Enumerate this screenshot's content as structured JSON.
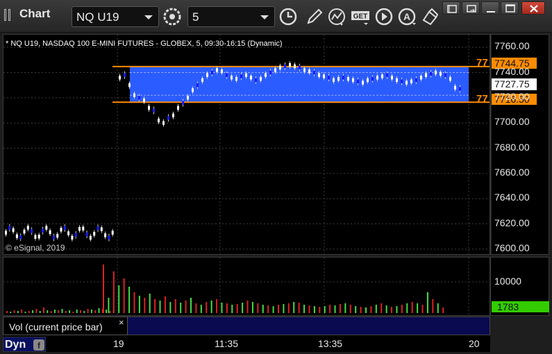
{
  "toolbar": {
    "title": "Chart",
    "symbol": "NQ U19",
    "interval": "5",
    "buttons": [
      "link-icon",
      "time-template-icon",
      "draw-pencil-icon",
      "studies-icon",
      "get-icon",
      "play-icon",
      "draw-a-icon",
      "cursor-icon"
    ],
    "window_buttons": [
      "lock-icon",
      "restore-icon",
      "maximize-icon",
      "close-icon"
    ]
  },
  "chart": {
    "title": "* NQ U19, NASDAQ 100 E-MINI FUTURES - GLOBEX, 5, 09:30-16:15 (Dynamic)",
    "copyright": "© eSignal, 2019",
    "price_ticks": [
      "7760.00",
      "7740.00",
      "7720.00",
      "7700.00",
      "7680.00",
      "7660.00",
      "7640.00",
      "7620.00",
      "7600.00"
    ],
    "range_high": {
      "label": "77",
      "value": "7744.75"
    },
    "range_low": {
      "label": "77",
      "value": "7716.50"
    },
    "last_price": "7727.75",
    "volume_tick": "10000",
    "volume_last": "1783",
    "time_ticks": [
      "19",
      "11:35",
      "13:35",
      "20"
    ],
    "colors": {
      "range_fill": "#2b5cff",
      "range_line": "#ff8c00",
      "up": "#ffffff",
      "down": "#1b1bff",
      "vol_up": "#44dd44",
      "vol_down": "#dd2222",
      "vol_last": "#33cc00"
    }
  },
  "volume_study": {
    "label": "Vol (current price bar)",
    "close": "×"
  },
  "status": {
    "mode": "Dyn"
  }
}
